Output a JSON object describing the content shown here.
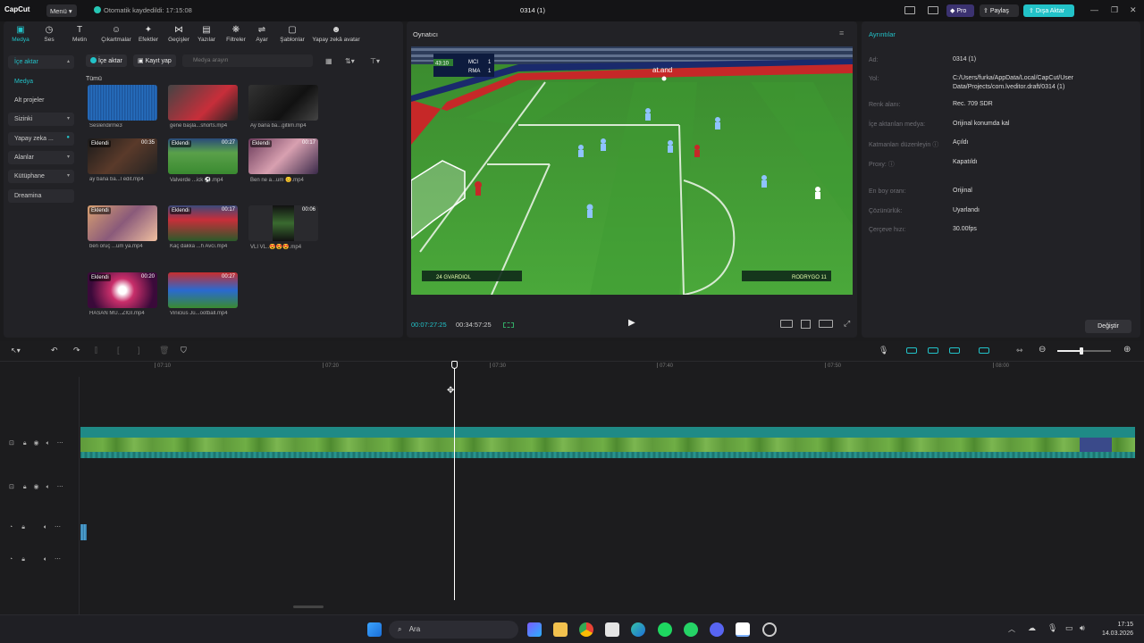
{
  "titlebar": {
    "logo": "CapCut",
    "menu_label": "Menü",
    "autosave_text": "Otomatik kaydedildi: 17:15:08",
    "project_title": "0314 (1)",
    "pro_label": "Pro",
    "share_label": "Paylaş",
    "export_label": "Dışa Aktar"
  },
  "toolbar": {
    "tabs": [
      {
        "label": "Medya",
        "icon": "media-icon"
      },
      {
        "label": "Ses",
        "icon": "audio-icon"
      },
      {
        "label": "Metin",
        "icon": "text-icon"
      },
      {
        "label": "Çıkartmalar",
        "icon": "sticker-icon"
      },
      {
        "label": "Efektler",
        "icon": "effects-icon"
      },
      {
        "label": "Geçişler",
        "icon": "transitions-icon"
      },
      {
        "label": "Yazılar",
        "icon": "captions-icon"
      },
      {
        "label": "Filtreler",
        "icon": "filters-icon"
      },
      {
        "label": "Ayar",
        "icon": "adjust-icon"
      },
      {
        "label": "Şablonlar",
        "icon": "templates-icon"
      },
      {
        "label": "Yapay zekâ avatar",
        "icon": "ai-avatar-icon"
      }
    ]
  },
  "sidebar": {
    "items": [
      {
        "label": "İçe aktar"
      },
      {
        "label": "Medya"
      },
      {
        "label": "Alt projeler"
      },
      {
        "label": "Sizinki"
      },
      {
        "label": "Yapay zeka ..."
      },
      {
        "label": "Alanlar"
      },
      {
        "label": "Kütüphane"
      },
      {
        "label": "Dreamina"
      }
    ]
  },
  "media": {
    "import_label": "İçe aktar",
    "record_label": "Kayıt yap",
    "search_placeholder": "Medya arayın",
    "all_label": "Tümü",
    "items": [
      {
        "caption": "Seslendirme3",
        "badge": "",
        "duration": ""
      },
      {
        "caption": "gene başla...shorts.mp4",
        "badge": "",
        "duration": ""
      },
      {
        "caption": "Ay bana ba...gitlim.mp4",
        "badge": "",
        "duration": ""
      },
      {
        "caption": "ay bana ba...l edit.mp4",
        "badge": "Eklendi",
        "duration": "00:35"
      },
      {
        "caption": "Valverde ...ick ⚽.mp4",
        "badge": "Eklendi",
        "duration": "00:27"
      },
      {
        "caption": "Ben ne a...um 😊.mp4",
        "badge": "Eklendi",
        "duration": "00:17"
      },
      {
        "caption": "ben oruç ...um ya.mp4",
        "badge": "Eklendi",
        "duration": ""
      },
      {
        "caption": "Kaç dakka ...h Avcı.mp4",
        "badge": "Eklendi",
        "duration": "00:17"
      },
      {
        "caption": "VLI VL..😍😍😍.mp4",
        "badge": "",
        "duration": "00:06"
      },
      {
        "caption": "HASAN MU...ZİGİ.mp4",
        "badge": "Eklendi",
        "duration": "00:20"
      },
      {
        "caption": "Vinicius Jú...ootball.mp4",
        "badge": "",
        "duration": "00:27"
      }
    ]
  },
  "player": {
    "title": "Oynatıcı",
    "current_time": "00:07:27:25",
    "total_time": "00:34:57:25",
    "scoreboard": {
      "time": "43:10",
      "home": "MCI",
      "away": "RMA",
      "home_score": "1",
      "away_score": "1"
    },
    "player_left": "24 GVARDIOL",
    "player_right": "RODRYGO 11",
    "ad_text": "at.and"
  },
  "details": {
    "title": "Ayrıntılar",
    "rows": [
      {
        "label": "Ad:",
        "value": "0314 (1)"
      },
      {
        "label": "Yol:",
        "value": "C:/Users/furka/AppData/Local/CapCut/User Data/Projects/com.lveditor.draft/0314 (1)"
      },
      {
        "label": "Renk alanı:",
        "value": "Rec. 709 SDR"
      },
      {
        "label": "İçe aktarılan medya:",
        "value": "Orijinal konumda kal"
      },
      {
        "label": "Katmanları düzenleyin ⓘ",
        "value": "Açıldı"
      },
      {
        "label": "Proxy: ⓘ",
        "value": "Kapatıldı"
      },
      {
        "label": "En boy oranı:",
        "value": "Orijinal"
      },
      {
        "label": "Çözünürlük:",
        "value": "Uyarlandı"
      },
      {
        "label": "Çerçeve hızı:",
        "value": "30.00fps"
      }
    ],
    "change_label": "Değiştir"
  },
  "timeline": {
    "ticks": [
      "07:10",
      "07:20",
      "07:30",
      "07:40",
      "07:50",
      "08:00"
    ]
  },
  "taskbar": {
    "search_label": "Ara",
    "time": "17:15",
    "date": "14.03.2026"
  },
  "colors": {
    "accent": "#22c2c8",
    "pro": "#3b3270",
    "track": "#1f8a86"
  }
}
